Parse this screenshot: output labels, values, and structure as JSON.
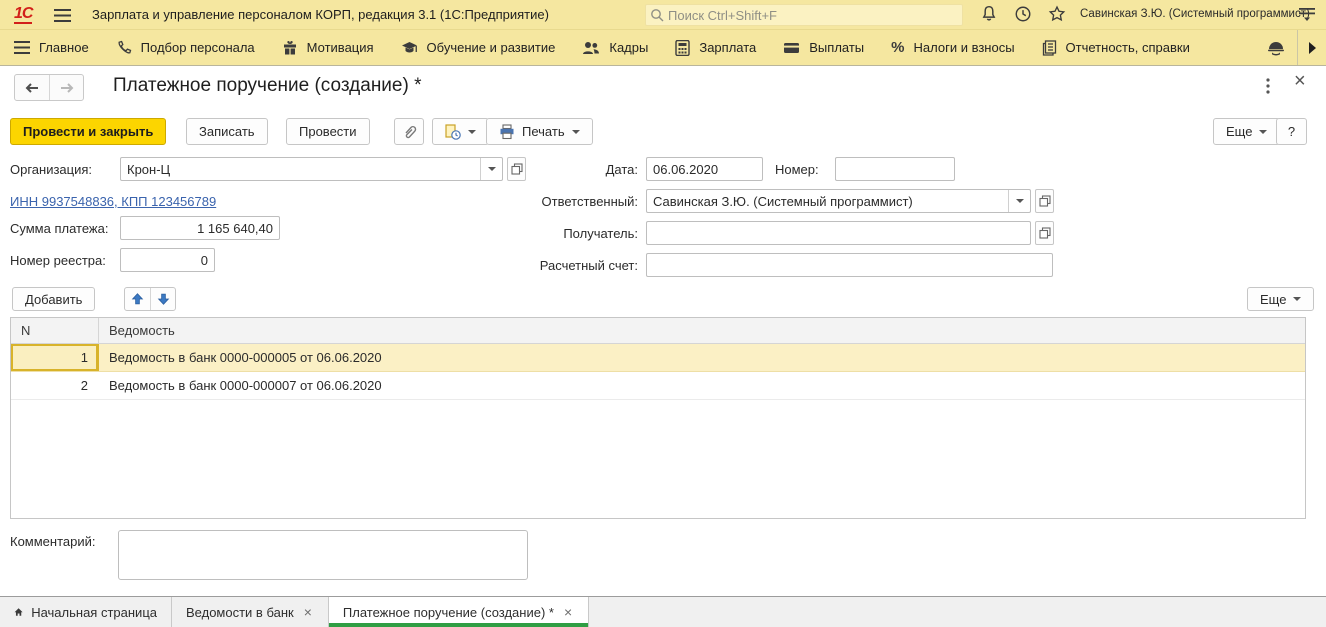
{
  "app": {
    "logo_text": "1С",
    "title": "Зарплата и управление персоналом КОРП, редакция 3.1  (1С:Предприятие)",
    "search_placeholder": "Поиск Ctrl+Shift+F",
    "user": "Савинская З.Ю. (Системный программист)",
    "top_icons": [
      "notifications-bell-icon",
      "history-clock-icon",
      "favorites-star-icon",
      "user-menu-icon"
    ]
  },
  "menu": {
    "items": [
      {
        "label": "Главное",
        "icon": "hamburger-icon"
      },
      {
        "label": "Подбор персонала",
        "icon": "phone-icon"
      },
      {
        "label": "Мотивация",
        "icon": "gift-icon"
      },
      {
        "label": "Обучение и развитие",
        "icon": "graduation-icon"
      },
      {
        "label": "Кадры",
        "icon": "people-icon"
      },
      {
        "label": "Зарплата",
        "icon": "calculator-icon"
      },
      {
        "label": "Выплаты",
        "icon": "wallet-icon"
      },
      {
        "label": "Налоги и взносы",
        "icon": "percent-icon",
        "icon_glyph": "%"
      },
      {
        "label": "Отчетность, справки",
        "icon": "report-icon"
      },
      {
        "label": "",
        "icon": "helmet-icon"
      }
    ]
  },
  "form": {
    "title": "Платежное поручение (создание) *",
    "toolbar": {
      "post_and_close": "Провести и закрыть",
      "write": "Записать",
      "post": "Провести",
      "print": "Печать",
      "more": "Еще",
      "help": "?"
    },
    "fields": {
      "org_label": "Организация:",
      "org_value": "Крон-Ц",
      "inn_link": "ИНН 9937548836, КПП 123456789",
      "sum_label": "Сумма платежа:",
      "sum_value": "1 165 640,40",
      "registry_label": "Номер реестра:",
      "registry_value": "0",
      "date_label": "Дата:",
      "date_value": "06.06.2020",
      "number_label": "Номер:",
      "number_value": "",
      "responsible_label": "Ответственный:",
      "responsible_value": "Савинская З.Ю. (Системный программист)",
      "recipient_label": "Получатель:",
      "recipient_value": "",
      "account_label": "Расчетный счет:",
      "account_value": ""
    },
    "table": {
      "add_button": "Добавить",
      "more_button": "Еще",
      "columns": {
        "n": "N",
        "statement": "Ведомость"
      },
      "rows": [
        {
          "n": "1",
          "statement": "Ведомость в банк 0000-000005 от 06.06.2020"
        },
        {
          "n": "2",
          "statement": "Ведомость в банк 0000-000007 от 06.06.2020"
        }
      ]
    },
    "comment_label": "Комментарий:"
  },
  "tabs": {
    "home": "Начальная страница",
    "statements": "Ведомости в банк",
    "payment_order": "Платежное поручение (создание) *"
  },
  "colors": {
    "topbar_yellow": "#F5E7A0",
    "brand_red": "#D2201A",
    "primary_button_yellow": "#FCD500",
    "link_blue": "#3A63AD",
    "selected_row": "#FBF0C5",
    "active_tab_green": "#2F9E44"
  }
}
